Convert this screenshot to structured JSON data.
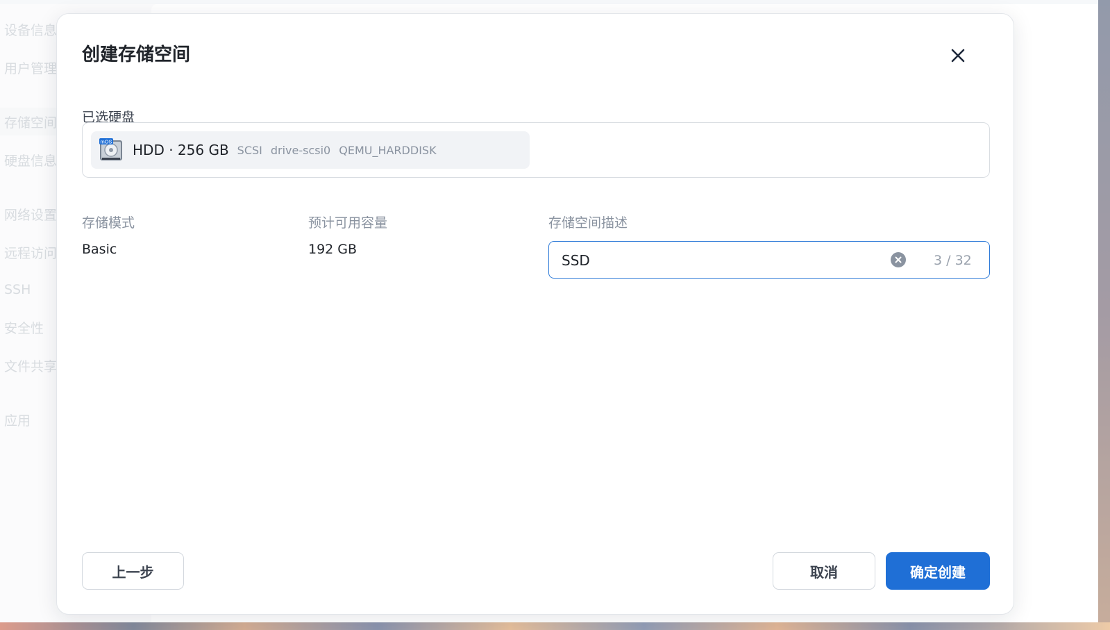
{
  "sidebar": {
    "items": [
      {
        "label": "设备信息"
      },
      {
        "label": "用户管理"
      },
      {
        "label": "存储空间"
      },
      {
        "label": "硬盘信息"
      },
      {
        "label": "网络设置"
      },
      {
        "label": "远程访问"
      },
      {
        "label": "SSH"
      },
      {
        "label": "安全性"
      },
      {
        "label": "文件共享"
      },
      {
        "label": "应用"
      }
    ]
  },
  "modal": {
    "title": "创建存储空间",
    "selected_disks_label": "已选硬盘",
    "disk": {
      "badge": "mOS",
      "main": "HDD · 256 GB",
      "interface": "SCSI",
      "device": "drive-scsi0",
      "model": "QEMU_HARDDISK"
    },
    "storage_mode": {
      "label": "存储模式",
      "value": "Basic"
    },
    "capacity": {
      "label": "预计可用容量",
      "value": "192 GB"
    },
    "description": {
      "label": "存储空间描述",
      "value": "SSD",
      "count": "3 / 32"
    },
    "buttons": {
      "back": "上一步",
      "cancel": "取消",
      "confirm": "确定创建"
    }
  },
  "colors": {
    "primary": "#1f6fd6",
    "input_focus": "#2f7bd8"
  }
}
